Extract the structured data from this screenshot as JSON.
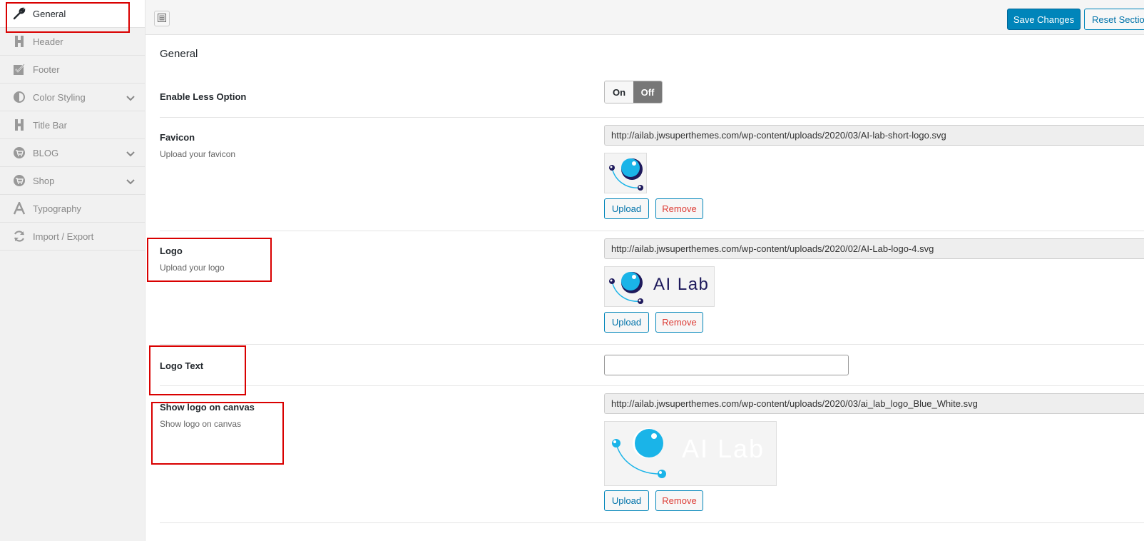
{
  "sidebar": {
    "items": [
      {
        "label": "General",
        "icon": "wrench-icon",
        "active": true
      },
      {
        "label": "Header",
        "icon": "header-icon"
      },
      {
        "label": "Footer",
        "icon": "checkbox-icon"
      },
      {
        "label": "Color Styling",
        "icon": "contrast-icon",
        "has_children": true
      },
      {
        "label": "Title Bar",
        "icon": "header-icon"
      },
      {
        "label": "BLOG",
        "icon": "cart-icon",
        "has_children": true
      },
      {
        "label": "Shop",
        "icon": "cart-icon",
        "has_children": true
      },
      {
        "label": "Typography",
        "icon": "font-icon"
      },
      {
        "label": "Import / Export",
        "icon": "refresh-icon"
      }
    ]
  },
  "toolbar": {
    "save_label": "Save Changes",
    "reset_label": "Reset Section"
  },
  "main": {
    "section_title": "General",
    "enable_less": {
      "title": "Enable Less Option",
      "on_label": "On",
      "off_label": "Off",
      "value": "Off"
    },
    "favicon": {
      "title": "Favicon",
      "desc": "Upload your favicon",
      "url": "http://ailab.jwsuperthemes.com/wp-content/uploads/2020/03/AI-lab-short-logo.svg",
      "upload_label": "Upload",
      "remove_label": "Remove"
    },
    "logo": {
      "title": "Logo",
      "desc": "Upload your logo",
      "url": "http://ailab.jwsuperthemes.com/wp-content/uploads/2020/02/AI-Lab-logo-4.svg",
      "logo_text": "AI Lab",
      "upload_label": "Upload",
      "remove_label": "Remove"
    },
    "logo_text": {
      "title": "Logo Text",
      "value": ""
    },
    "canvas_logo": {
      "title": "Show logo on canvas",
      "desc": "Show logo on canvas",
      "url": "http://ailab.jwsuperthemes.com/wp-content/uploads/2020/03/ai_lab_logo_Blue_White.svg",
      "logo_text": "AI Lab",
      "upload_label": "Upload",
      "remove_label": "Remove"
    }
  },
  "colors": {
    "primary": "#0085ba",
    "highlight": "#d90000",
    "logo_dark": "#1e1a5c",
    "logo_light": "#1ab4e8"
  }
}
